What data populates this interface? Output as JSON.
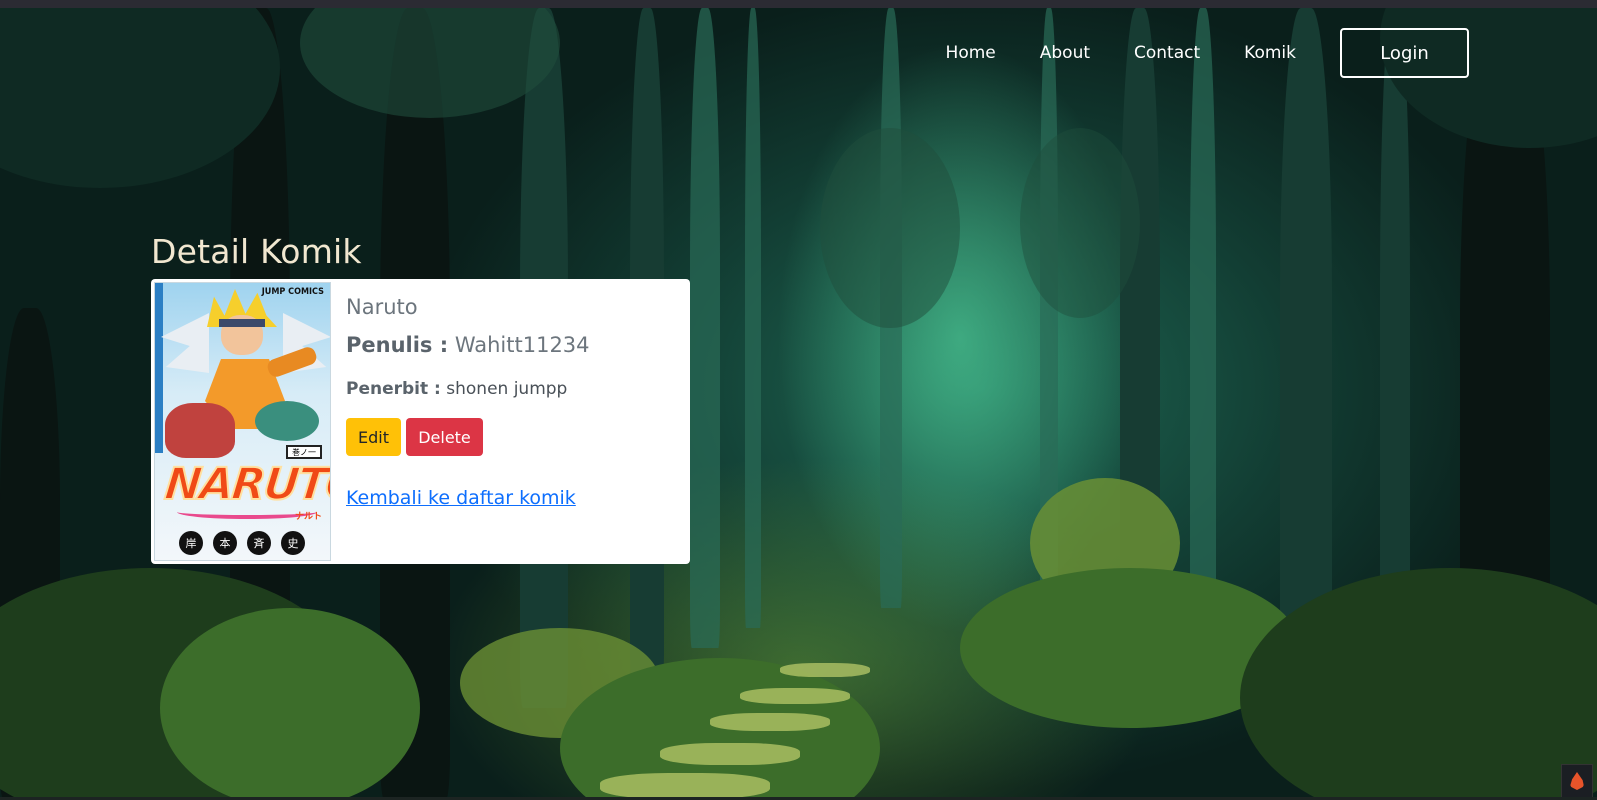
{
  "nav": {
    "links": [
      "Home",
      "About",
      "Contact",
      "Komik"
    ],
    "login_label": "Login"
  },
  "page": {
    "title": "Detail Komik"
  },
  "comic": {
    "title": "Naruto",
    "writer_label": "Penulis :",
    "writer": "Wahitt11234",
    "publisher_label": "Penerbit :",
    "publisher": "shonen jumpp",
    "cover": {
      "publisher_mark": "JUMP COMICS",
      "logo_text": "NARUTO",
      "logo_kana": "ナルト",
      "volume": "巻ノ一",
      "author_seals": [
        "岸",
        "本",
        "斉",
        "史"
      ]
    }
  },
  "actions": {
    "edit_label": "Edit",
    "delete_label": "Delete",
    "back_label": "Kembali ke daftar komik"
  },
  "colors": {
    "edit": "#ffc107",
    "delete": "#dc3545",
    "link": "#0d6efd",
    "title": "#f1e7d0"
  },
  "icons": {
    "corner_widget": "flame-icon"
  }
}
